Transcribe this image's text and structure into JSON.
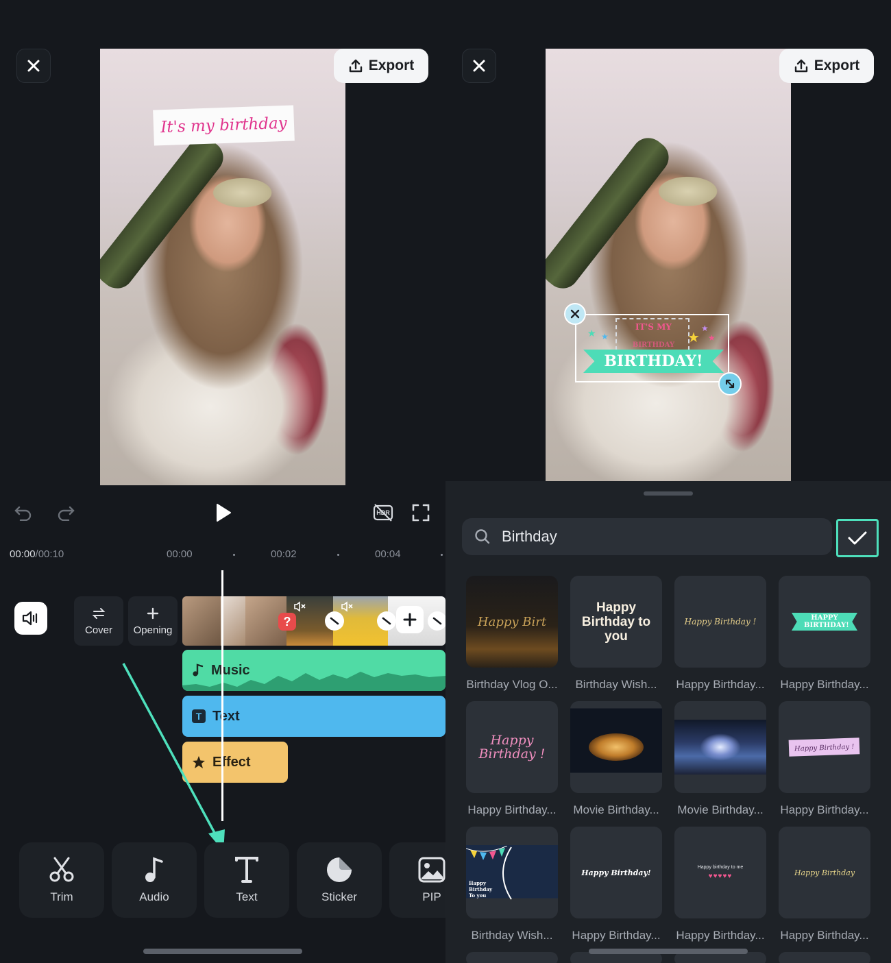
{
  "left": {
    "export_label": "Export",
    "overlay_text": "It's my birthday",
    "time_current": "00:00",
    "time_total": "/00:10",
    "ticks": [
      "00:00",
      "00:02",
      "00:04"
    ],
    "clip_buttons": [
      {
        "label": "Cover",
        "icon": "swap-icon"
      },
      {
        "label": "Opening",
        "icon": "plus-icon"
      }
    ],
    "tracks": [
      {
        "label": "Music",
        "color": "#50dba5"
      },
      {
        "label": "Text",
        "color": "#4fb8ee"
      },
      {
        "label": "Effect",
        "color": "#f3c46c"
      }
    ],
    "toolbar": [
      {
        "label": "Trim",
        "icon": "scissors-icon"
      },
      {
        "label": "Audio",
        "icon": "music-note-icon"
      },
      {
        "label": "Text",
        "icon": "text-icon"
      },
      {
        "label": "Sticker",
        "icon": "sticker-icon"
      },
      {
        "label": "PIP",
        "icon": "image-icon"
      }
    ],
    "hdr_label": "HDR"
  },
  "right": {
    "export_label": "Export",
    "sticker_small": "IT'S MY",
    "sticker_sub": "BIRTHDAY",
    "sticker_big": "BIRTHDAY!",
    "search": {
      "value": "Birthday"
    },
    "templates": [
      {
        "label": "Birthday Vlog O...",
        "preview": "Happy Birt"
      },
      {
        "label": "Birthday Wish...",
        "preview": "Happy Birthday to you"
      },
      {
        "label": "Happy Birthday...",
        "preview": "Happy Birthday !"
      },
      {
        "label": "Happy Birthday...",
        "preview": "HAPPY BIRTHDAY!"
      },
      {
        "label": "Happy Birthday...",
        "preview": "Happy Birthday !"
      },
      {
        "label": "Movie Birthday...",
        "preview": ""
      },
      {
        "label": "Movie Birthday...",
        "preview": ""
      },
      {
        "label": "Happy Birthday...",
        "preview": "Happy Birthday !"
      },
      {
        "label": "Birthday Wish...",
        "preview": "Happy Birthday To you"
      },
      {
        "label": "Happy Birthday...",
        "preview": "Happy Birthday!"
      },
      {
        "label": "Happy Birthday...",
        "preview": "Happy birthday to me"
      },
      {
        "label": "Happy Birthday...",
        "preview": "Happy Birthday"
      }
    ]
  },
  "colors": {
    "accent": "#4ee0bc",
    "arrow": "#4ee0bc",
    "background": "#15181d"
  }
}
